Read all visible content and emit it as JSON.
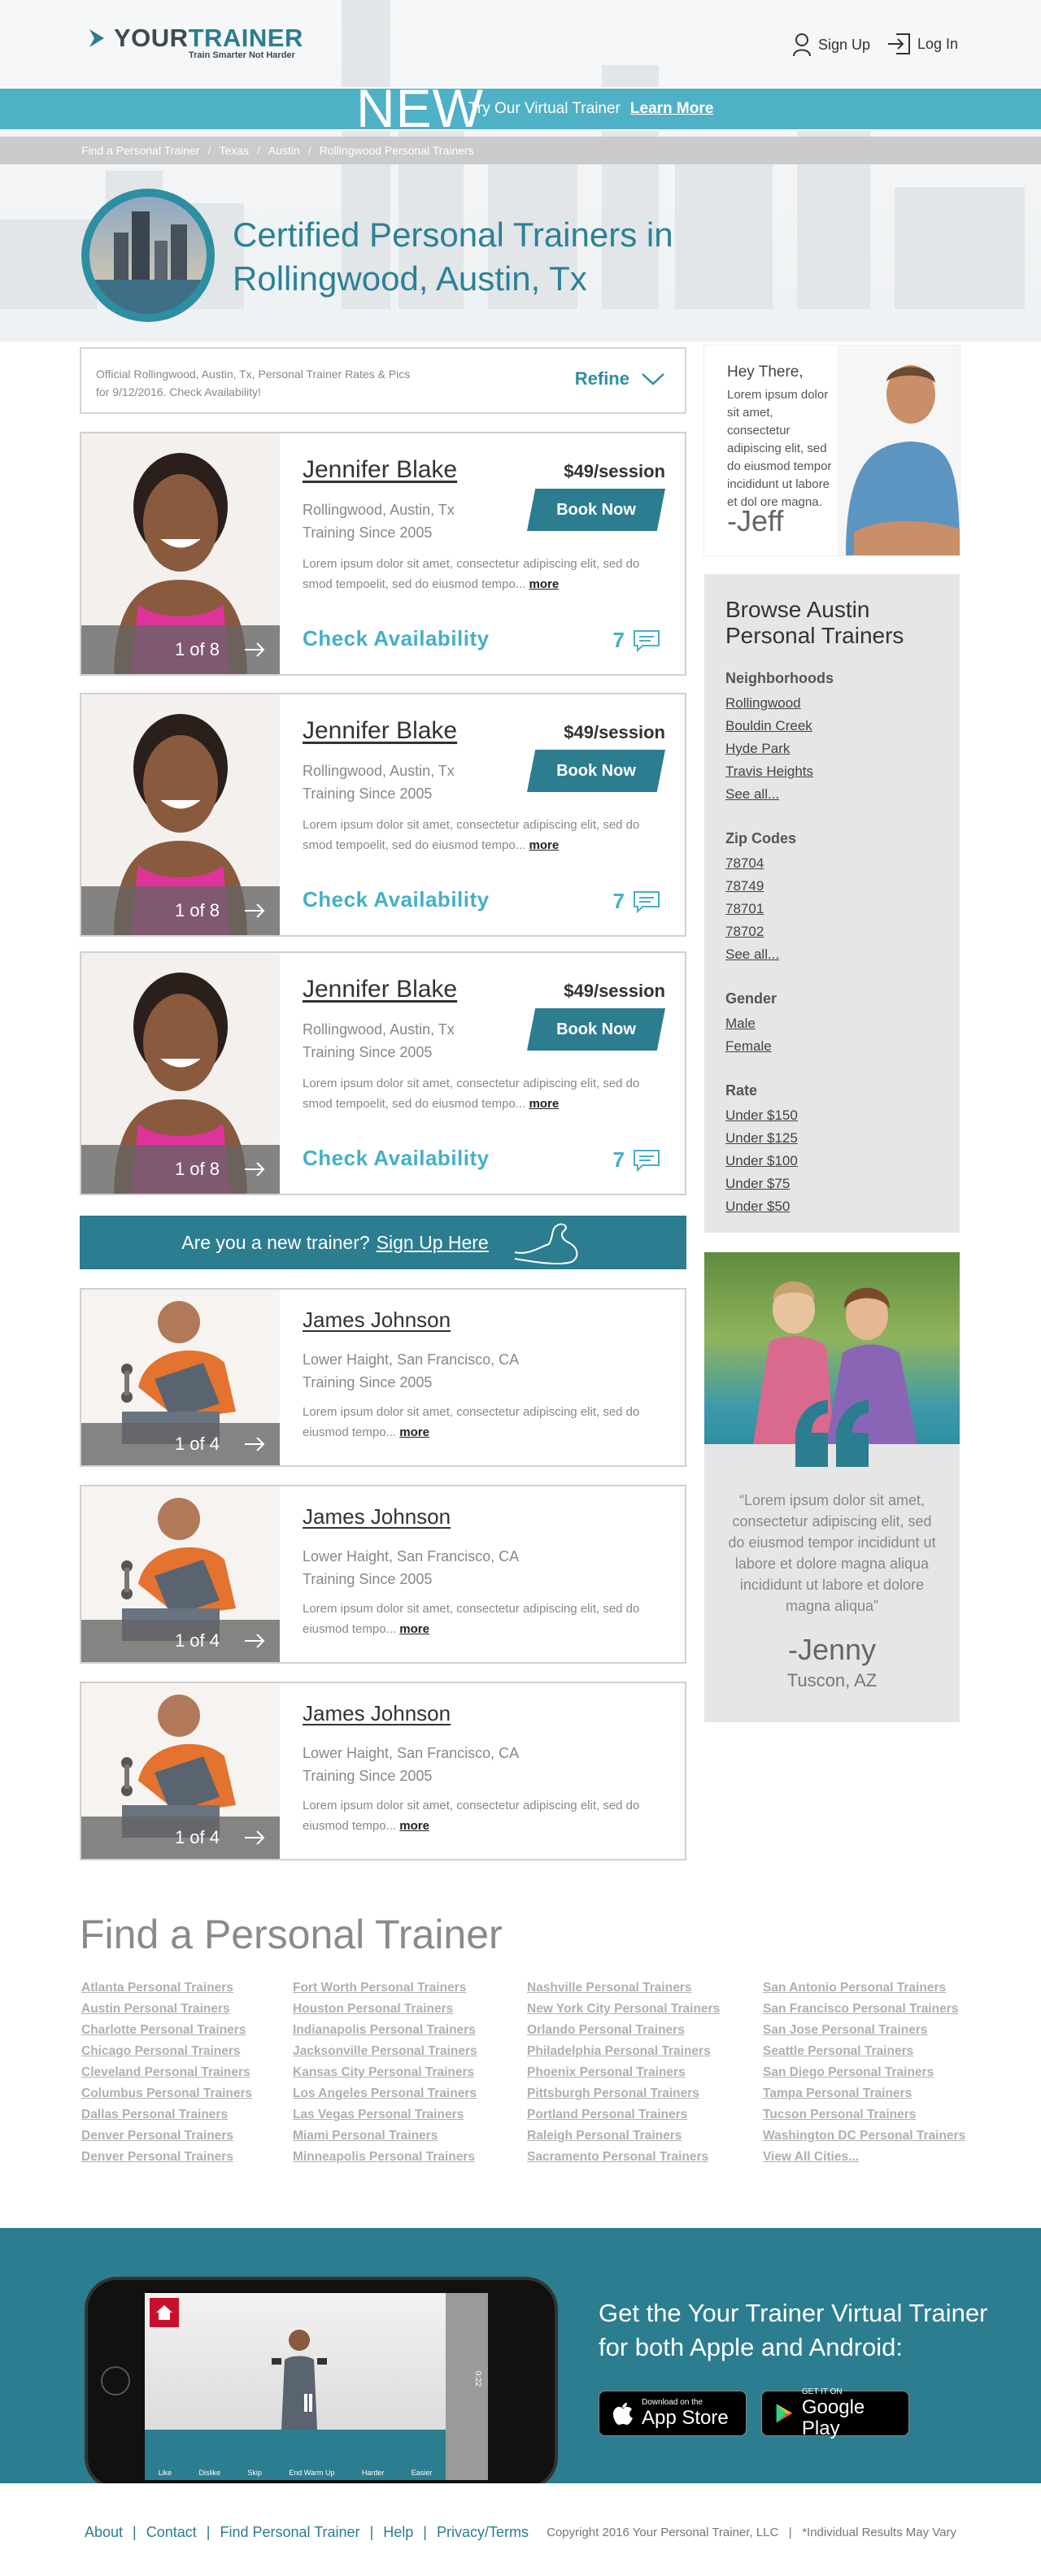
{
  "brand": {
    "name_1": "YOUR",
    "name_2": "TRAINER",
    "tagline": "Train Smarter Not Harder",
    "accent": "#2b7d8f",
    "light_accent": "#4fb1c6"
  },
  "header": {
    "signup": "Sign Up",
    "login": "Log In"
  },
  "banner": {
    "new": "NEW",
    "text": "Try Our Virtual Trainer",
    "link": "Learn More"
  },
  "breadcrumb": [
    "Find a Personal Trainer",
    "Texas",
    "Austin",
    "Rollingwood Personal Trainers"
  ],
  "title": {
    "line1": "Certified Personal Trainers in",
    "line2": "Rollingwood, Austin, Tx"
  },
  "refine": {
    "text": "Official Rollingwood, Austin, Tx,  Personal Trainer Rates & Pics for 9/12/2016. Check Availability!",
    "button": "Refine"
  },
  "featured_trainers": [
    {
      "name": "Jennifer Blake",
      "location": "Rollingwood, Austin, Tx",
      "since": "Training Since 2005",
      "price": "$49/session",
      "book": "Book Now",
      "desc": "Lorem ipsum dolor sit amet, consectetur adipiscing elit, sed do smod tempoelit, sed do eiusmod tempo...",
      "more": "more",
      "counter": "1 of 8",
      "availability": "Check Availability",
      "reviews": "7"
    },
    {
      "name": "Jennifer Blake",
      "location": "Rollingwood, Austin, Tx",
      "since": "Training Since 2005",
      "price": "$49/session",
      "book": "Book Now",
      "desc": "Lorem ipsum dolor sit amet, consectetur adipiscing elit, sed do smod tempoelit, sed do eiusmod tempo...",
      "more": "more",
      "counter": "1 of 8",
      "availability": "Check Availability",
      "reviews": "7"
    },
    {
      "name": "Jennifer Blake",
      "location": "Rollingwood, Austin, Tx",
      "since": "Training Since 2005",
      "price": "$49/session",
      "book": "Book Now",
      "desc": "Lorem ipsum dolor sit amet, consectetur adipiscing elit, sed do smod tempoelit, sed do eiusmod tempo...",
      "more": "more",
      "counter": "1 of 8",
      "availability": "Check Availability",
      "reviews": "7"
    }
  ],
  "signup_bar": {
    "text": "Are you a new trainer?",
    "link": "Sign Up Here"
  },
  "trainers": [
    {
      "name": "James Johnson",
      "location": "Lower Haight, San Francisco, CA",
      "since": "Training Since 2005",
      "desc": "Lorem ipsum dolor sit amet, consectetur adipiscing elit, sed do eiusmod tempo...",
      "more": "more",
      "counter": "1 of 4"
    },
    {
      "name": "James Johnson",
      "location": "Lower Haight, San Francisco, CA",
      "since": "Training Since 2005",
      "desc": "Lorem ipsum dolor sit amet, consectetur adipiscing elit, sed do eiusmod tempo...",
      "more": "more",
      "counter": "1 of 4"
    },
    {
      "name": "James Johnson",
      "location": "Lower Haight, San Francisco, CA",
      "since": "Training Since 2005",
      "desc": "Lorem ipsum dolor sit amet, consectetur adipiscing elit, sed do eiusmod tempo...",
      "more": "more",
      "counter": "1 of 4"
    }
  ],
  "jeff": {
    "hey": "Hey There,",
    "text": "Lorem ipsum dolor sit amet, consectetur adipiscing elit, sed do eiusmod tempor incididunt ut labore et dol ore magna.",
    "sign": "-Jeff"
  },
  "browse": {
    "title": "Browse Austin Personal Trainers",
    "groups": [
      {
        "heading": "Neighborhoods",
        "links": [
          "Rollingwood",
          "Bouldin Creek",
          "Hyde Park",
          "Travis Heights",
          "See all..."
        ]
      },
      {
        "heading": "Zip Codes",
        "links": [
          "78704",
          "78749",
          "78701",
          "78702",
          "See all..."
        ]
      },
      {
        "heading": "Gender",
        "links": [
          "Male",
          "Female"
        ]
      },
      {
        "heading": "Rate",
        "links": [
          "Under $150",
          "Under $125",
          "Under $100",
          "Under $75",
          "Under $50"
        ]
      }
    ]
  },
  "testimonial": {
    "quote": "“Lorem ipsum dolor sit amet, consectetur adipiscing elit, sed do eiusmod tempor incididunt ut labore et dolore magna aliqua incididunt ut labore et dolore magna aliqua”",
    "name": "-Jenny",
    "location": "Tuscon, AZ"
  },
  "find": {
    "title": "Find a Personal Trainer",
    "columns": [
      [
        "Atlanta Personal Trainers",
        "Austin Personal Trainers",
        "Charlotte Personal Trainers",
        "Chicago Personal Trainers",
        "Cleveland Personal Trainers",
        "Columbus Personal Trainers",
        "Dallas Personal Trainers",
        "Denver Personal Trainers",
        "Denver Personal Trainers"
      ],
      [
        "Fort Worth Personal Trainers",
        "Houston Personal Trainers",
        "Indianapolis Personal Trainers",
        "Jacksonville Personal Trainers",
        "Kansas City Personal Trainers",
        "Los Angeles Personal Trainers",
        "Las Vegas Personal Trainers",
        "Miami Personal Trainers",
        "Minneapolis Personal Trainers"
      ],
      [
        "Nashville Personal Trainers",
        "New York City Personal Trainers",
        "Orlando Personal Trainers",
        "Philadelphia Personal Trainers",
        "Phoenix Personal Trainers",
        "Pittsburgh Personal Trainers",
        "Portland Personal Trainers",
        "Raleigh Personal Trainers",
        "Sacramento Personal Trainers"
      ],
      [
        "San Antonio Personal Trainers",
        "San Francisco Personal Trainers",
        "San Jose Personal Trainers",
        "Seattle Personal Trainers",
        "San Diego Personal Trainers",
        "Tampa Personal Trainers",
        "Tucson Personal Trainers",
        "Washington DC Personal Trainers",
        "View All Cities..."
      ]
    ]
  },
  "app": {
    "title_line1": "Get the Your Trainer Virtual Trainer",
    "title_line2": "for both Apple and Android:",
    "appstore_small": "Download on the",
    "appstore": "App Store",
    "gplay_small": "GET IT ON",
    "gplay": "Google Play",
    "controls": [
      "Like",
      "Dislike",
      "Skip",
      "End Warm Up",
      "Harder",
      "Easier"
    ],
    "timer": "0:22"
  },
  "footer": {
    "links": [
      "About",
      "Contact",
      "Find Personal Trainer",
      "Help",
      "Privacy/Terms"
    ],
    "copyright": "Copyright 2016 Your Personal Trainer, LLC   |   *Individual Results May Vary"
  }
}
